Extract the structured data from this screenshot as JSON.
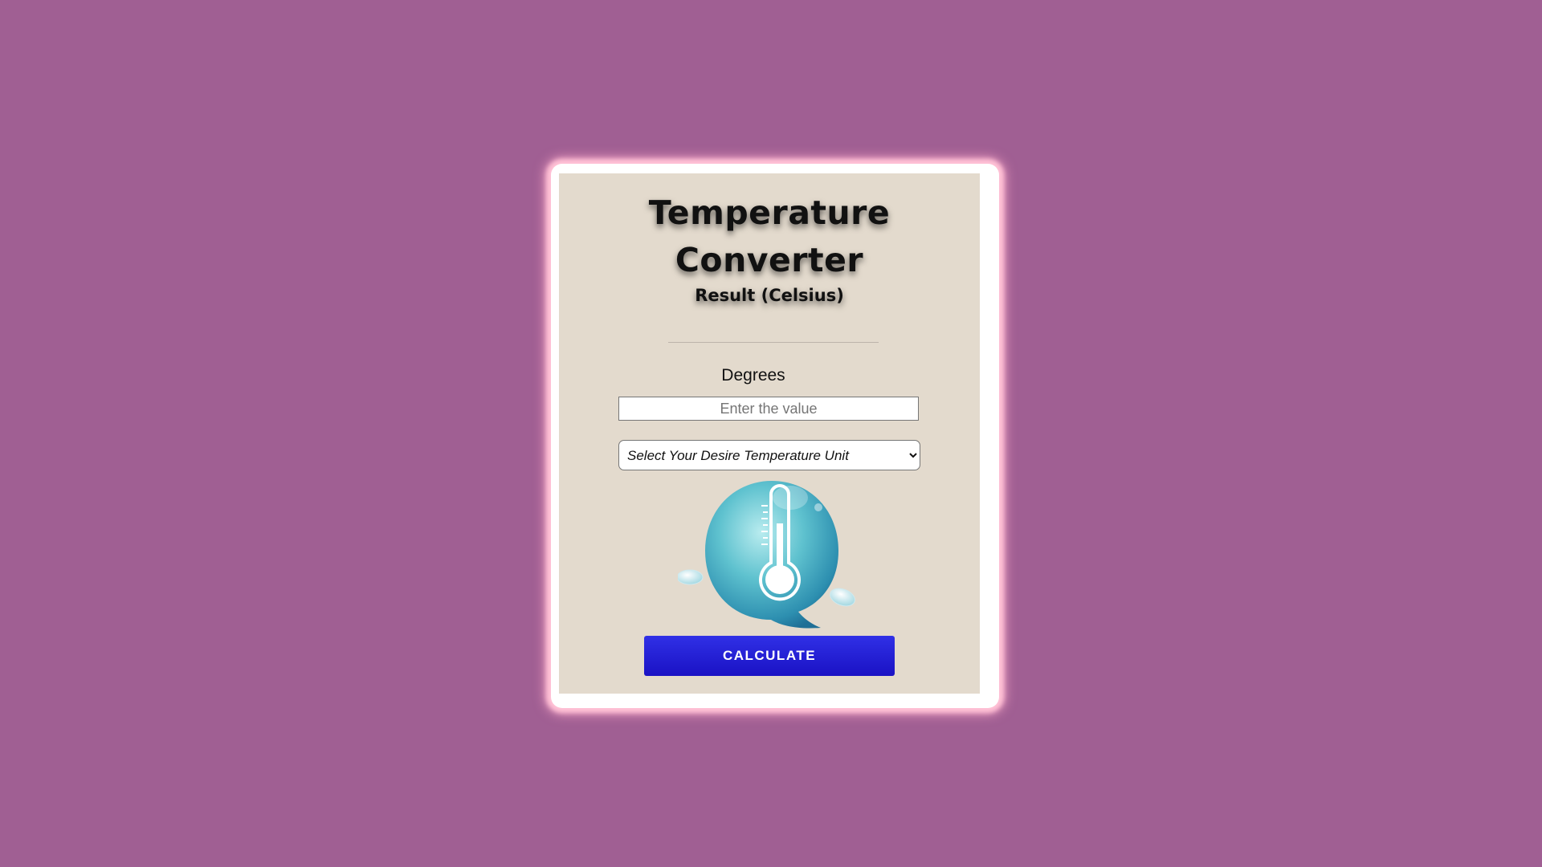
{
  "converter": {
    "title_line1": "Temperature",
    "title_line2": "Converter",
    "result_label": "Result (Celsius)",
    "degrees_label": "Degrees",
    "value_input": {
      "placeholder": "Enter the value",
      "value": ""
    },
    "unit_select": {
      "selected": "Select Your Desire Temperature Unit"
    },
    "illustration_icon": "thermometer-bubble-icon",
    "calculate_label": "CALCULATE"
  },
  "colors": {
    "page_background": "#a05f93",
    "card_background": "#e3dacd",
    "card_glow": "#ffc2d6",
    "button": "#2420d8"
  }
}
